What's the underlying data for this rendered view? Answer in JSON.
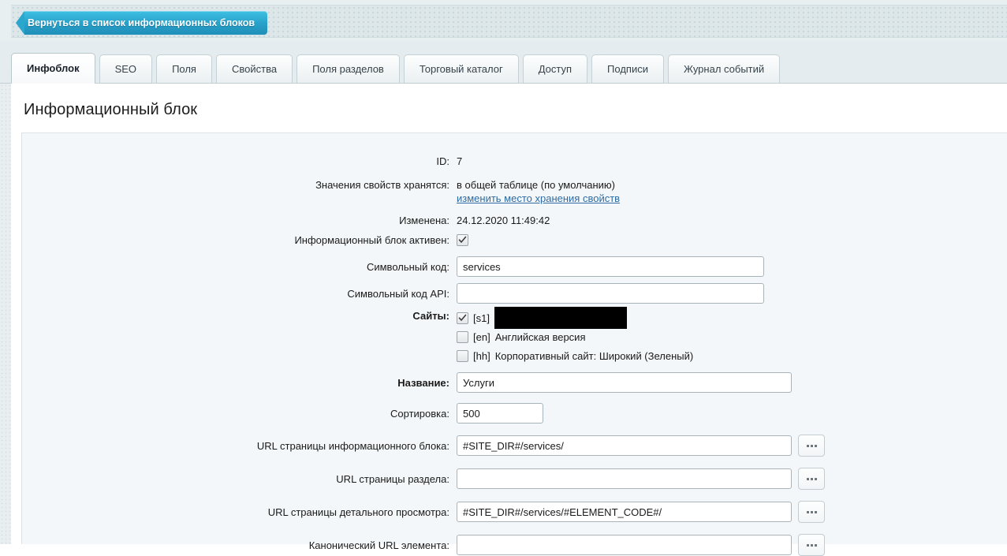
{
  "toolbar": {
    "back_button_label": "Вернуться в список информационных блоков"
  },
  "tabs": [
    {
      "label": "Инфоблок",
      "active": true
    },
    {
      "label": "SEO",
      "active": false
    },
    {
      "label": "Поля",
      "active": false
    },
    {
      "label": "Свойства",
      "active": false
    },
    {
      "label": "Поля разделов",
      "active": false
    },
    {
      "label": "Торговый каталог",
      "active": false
    },
    {
      "label": "Доступ",
      "active": false
    },
    {
      "label": "Подписи",
      "active": false
    },
    {
      "label": "Журнал событий",
      "active": false
    }
  ],
  "page": {
    "title": "Информационный блок"
  },
  "form": {
    "id": {
      "label": "ID:",
      "value": "7"
    },
    "storage": {
      "label": "Значения свойств хранятся:",
      "value": "в общей таблице (по умолчанию)",
      "link": "изменить место хранения свойств"
    },
    "modified": {
      "label": "Изменена:",
      "value": "24.12.2020 11:49:42"
    },
    "active": {
      "label": "Информационный блок активен:",
      "checked": true
    },
    "code": {
      "label": "Символьный код:",
      "value": "services",
      "placeholder": ""
    },
    "api_code": {
      "label": "Символьный код API:",
      "value": "",
      "placeholder": ""
    },
    "sites": {
      "label": "Сайты:",
      "items": [
        {
          "code": "[s1]",
          "name": "",
          "checked": true,
          "redacted": true
        },
        {
          "code": "[en]",
          "name": "Английская версия",
          "checked": false,
          "redacted": false
        },
        {
          "code": "[hh]",
          "name": "Корпоративный сайт: Широкий (Зеленый)",
          "checked": false,
          "redacted": false
        }
      ]
    },
    "name": {
      "label": "Название:",
      "value": "Услуги",
      "placeholder": ""
    },
    "sort": {
      "label": "Сортировка:",
      "value": "500",
      "placeholder": ""
    },
    "url_block": {
      "label": "URL страницы информационного блока:",
      "value": "#SITE_DIR#/services/",
      "placeholder": "",
      "browse": "..."
    },
    "url_section": {
      "label": "URL страницы раздела:",
      "value": "",
      "placeholder": "",
      "browse": "..."
    },
    "url_detail": {
      "label": "URL страницы детального просмотра:",
      "value": "#SITE_DIR#/services/#ELEMENT_CODE#/",
      "placeholder": "",
      "browse": "..."
    },
    "url_canonical": {
      "label": "Канонический URL элемента:",
      "value": "",
      "placeholder": "",
      "browse": "..."
    }
  }
}
